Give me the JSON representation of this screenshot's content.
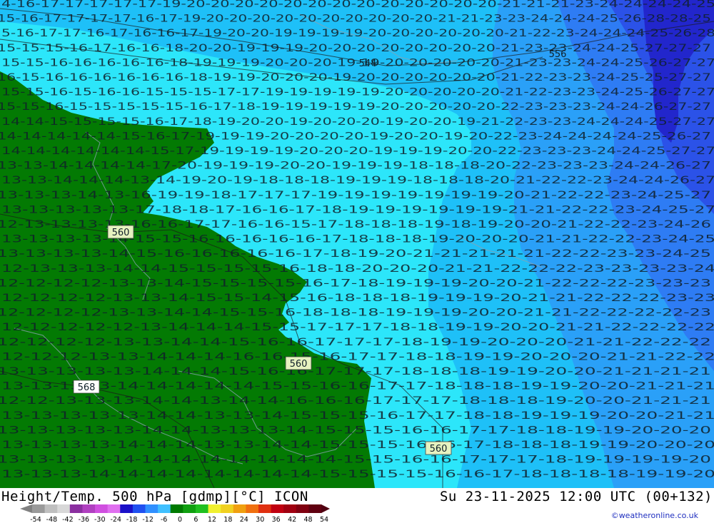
{
  "title": "Height/Temp. 500 hPa [gdmp][°C] ICON",
  "valid_time": "Su 23-11-2025 12:00 UTC (00+132)",
  "credit": "©weatheronline.co.uk",
  "contour_labels": [
    {
      "text": "544"
    },
    {
      "text": "556"
    },
    {
      "text": "560"
    },
    {
      "text": "560"
    },
    {
      "text": "560"
    },
    {
      "text": "568"
    }
  ],
  "legend": {
    "ticks": [
      "-54",
      "-48",
      "-42",
      "-36",
      "-30",
      "-24",
      "-18",
      "-12",
      "-6",
      "0",
      "6",
      "12",
      "18",
      "24",
      "30",
      "36",
      "42",
      "48",
      "54"
    ],
    "colors": [
      "#9a9a9a",
      "#bfbfbf",
      "#d8d8d8",
      "#8b2fa0",
      "#b040c0",
      "#d050e0",
      "#e070f0",
      "#1a10c8",
      "#2050f0",
      "#3090ff",
      "#40c0ff",
      "#007a00",
      "#10a010",
      "#20c020",
      "#f0f030",
      "#f0d020",
      "#f0a010",
      "#f07010",
      "#e03010",
      "#c00010",
      "#a00010",
      "#800010",
      "#600010"
    ]
  },
  "temperature_field": {
    "colors": {
      "land_green": "#037a03",
      "cyan": "#2ce6fa",
      "light_blue": "#1ec0f8",
      "mid_blue": "#2aa0f8",
      "blue": "#2e7cf4",
      "deep_blue": "#2b52e8",
      "darkest_blue": "#2226cc",
      "temp_text": "#10202a",
      "coast": "#8aa0b0"
    },
    "rows": [
      "4 16 17 17 17 17 17 19 20 20 20 20 20 20 20 20 20 20 20 20 20 21 21 21 23 24 24 24 24 25",
      "15 16 17 17 17 17 16 17 19 20 20 20 20 20 20 20 20 20 20 21 21 23 23 24 24 24 25 26 28 28 25",
      "5 16 17 17 16 17 16 16 17 19 20 20 19 19 19 19 20 20 20 20 20 20 21 22 23 24 24 24 25 26 28",
      "15 15 15 16 17 16 16 18 20 20 19 19 19 20 20 20 20 20 20 20 20 21 23 23 24 24 25 27 27 27",
      "15 15 16 16 16 16 16 18 19 19 19 20 20 20 19 19 20 20 20 20 20 21 23 23 24 24 25 26 27 27",
      "16 15 16 16 16 16 16 16 18 19 19 20 20 20 19 20 20 20 20 20 20 21 22 23 23 24 25 25 27 27",
      "15 15 16 15 16 16 15 15 15 17 17 19 19 19 19 19 20 20 20 20 20 21 22 23 23 24 25 26 27 27",
      "15 15 16 15 15 15 15 15 16 17 18 19 19 19 19 19 20 20 20 20 20 22 23 23 23 24 24 26 27 27",
      "14 14 15 15 15 15 16 17 18 19 20 20 19 20 20 20 19 20 20 19 21 22 23 23 24 24 24 25 27 27",
      "14 14 14 14 14 15 16 17 19 19 19 20 20 20 20 19 20 20 19 20 22 23 24 24 24 24 25 26 27",
      "14 14 14 14 14 14 15 17 19 19 19 19 20 20 20 19 19 19 20 20 22 23 23 23 24 24 25 27 27",
      "13 13 14 14 14 14 17 20 19 19 19 20 20 19 19 19 18 18 18 20 22 23 23 23 24 24 26 27",
      "13 13 14 14 14 13 14 19 20 19 18 18 18 19 19 19 18 18 18 20 21 22 22 23 24 24 26 27",
      "13 13 13 14 13 16 19 19 18 17 17 17 19 19 19 19 19 19 19 20 21 22 22 23 24 25 27",
      "13 13 13 13 13 17 18 18 17 16 16 17 18 19 19 19 19 19 19 21 21 22 22 23 24 25 27",
      "12 13 13 13 13 16 16 17 17 16 16 15 17 18 18 18 19 18 19 20 20 21 22 22 23 24 26",
      "13 13 13 13 14 15 15 16 16 16 16 16 17 18 18 18 19 20 20 20 21 21 22 22 23 24 25",
      "13 13 13 13 14 15 16 16 16 16 16 17 18 19 20 21 21 21 21 21 22 22 23 23 24 25",
      "12 13 13 13 14 14 15 15 15 15 16 18 18 20 20 20 21 21 22 22 22 23 23 23 23 24",
      "12 12 12 12 13 13 14 15 15 15 15 16 17 18 19 19 19 20 20 21 22 22 22 23 23 23",
      "12 12 12 12 13 13 14 15 15 14 15 16 18 18 18 19 19 19 20 21 21 22 22 22 23 23",
      "12 12 12 12 13 13 14 14 15 15 16 18 18 18 19 19 19 20 20 21 21 22 22 22 22 23",
      "12 12 12 12 12 13 14 14 14 15 15 17 17 17 18 18 19 19 20 20 21 21 22 22 22 22",
      "12 12 12 12 13 13 14 14 15 16 16 17 17 17 18 19 19 20 20 20 21 21 22 22 22",
      "12 12 12 13 13 14 14 14 16 16 15 16 17 17 18 18 19 19 20 20 20 21 21 22 22",
      "13 13 13 13 13 14 14 14 15 16 16 17 17 17 18 18 18 19 19 20 20 21 21 21 21",
      "13 13 13 13 14 14 14 14 14 15 15 16 16 17 17 18 18 18 19 19 20 20 21 21 21",
      "12 12 13 13 13 14 14 13 14 14 16 16 16 17 17 17 18 18 18 19 20 20 21 21 21",
      "13 13 13 13 13 14 14 13 13 14 15 15 15 16 17 17 18 18 19 19 19 20 20 21 21",
      "13 13 13 13 13 14 14 13 13 13 14 15 15 15 16 16 17 17 18 18 19 19 20 20 20",
      "13 13 13 13 14 14 14 13 13 14 14 15 15 15 16 16 17 18 18 18 19 19 20 20 20",
      "13 13 13 13 14 14 14 14 14 14 14 14 15 15 16 16 17 17 17 18 19 19 19 19 20",
      "13 13 13 14 14 14 14 14 14 14 14 15 15 15 15 16 16 17 18 18 18 18 19 19 20"
    ]
  }
}
